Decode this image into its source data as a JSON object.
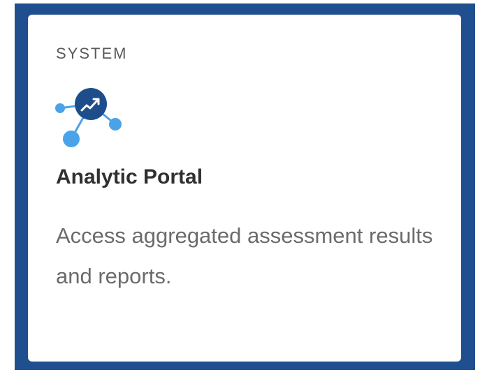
{
  "card": {
    "category": "SYSTEM",
    "title": "Analytic Portal",
    "description": "Access aggregated assessment results and reports.",
    "icon": "analytics-network-icon"
  },
  "colors": {
    "frame": "#1f4f8f",
    "icon_dark": "#1d4e8b",
    "icon_light": "#4aa3e8",
    "title": "#303030",
    "text": "#6b6b6b"
  }
}
